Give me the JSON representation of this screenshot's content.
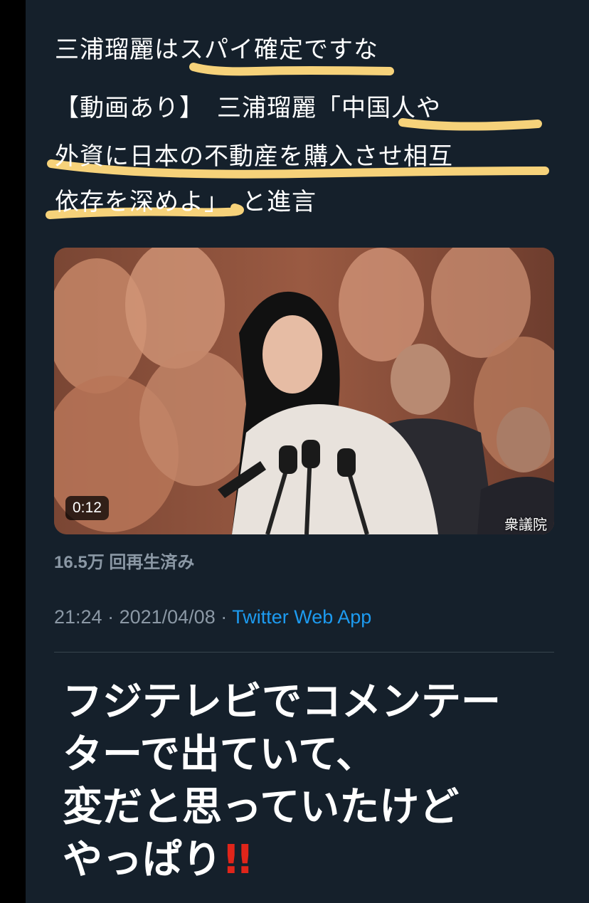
{
  "tweet": {
    "line1": "三浦瑠麗はスパイ確定ですな",
    "line2_prefix": "【動画あり】　三浦瑠麗「",
    "line2_quote": "中国人や",
    "line3": "外資に日本の不動産を購入させ相互",
    "line4_quote": "依存を深めよ",
    "line4_suffix": "」　と進言"
  },
  "video": {
    "duration": "0:12",
    "overlay_text": "衆議院"
  },
  "views": "16.5万 回再生済み",
  "meta": {
    "time": "21:24",
    "sep1": " · ",
    "date": "2021/04/08",
    "sep2": " · ",
    "source": "Twitter Web App"
  },
  "comment": {
    "line1": "フジテレビでコメンテー",
    "line2": "ターで出ていて、",
    "line3": "変だと思っていたけど",
    "line4": "やっぱり",
    "emoji": "!!"
  },
  "colors": {
    "background": "#15202b",
    "highlight": "#f6d27a",
    "link": "#1d9bf0",
    "muted": "#8b98a5"
  }
}
